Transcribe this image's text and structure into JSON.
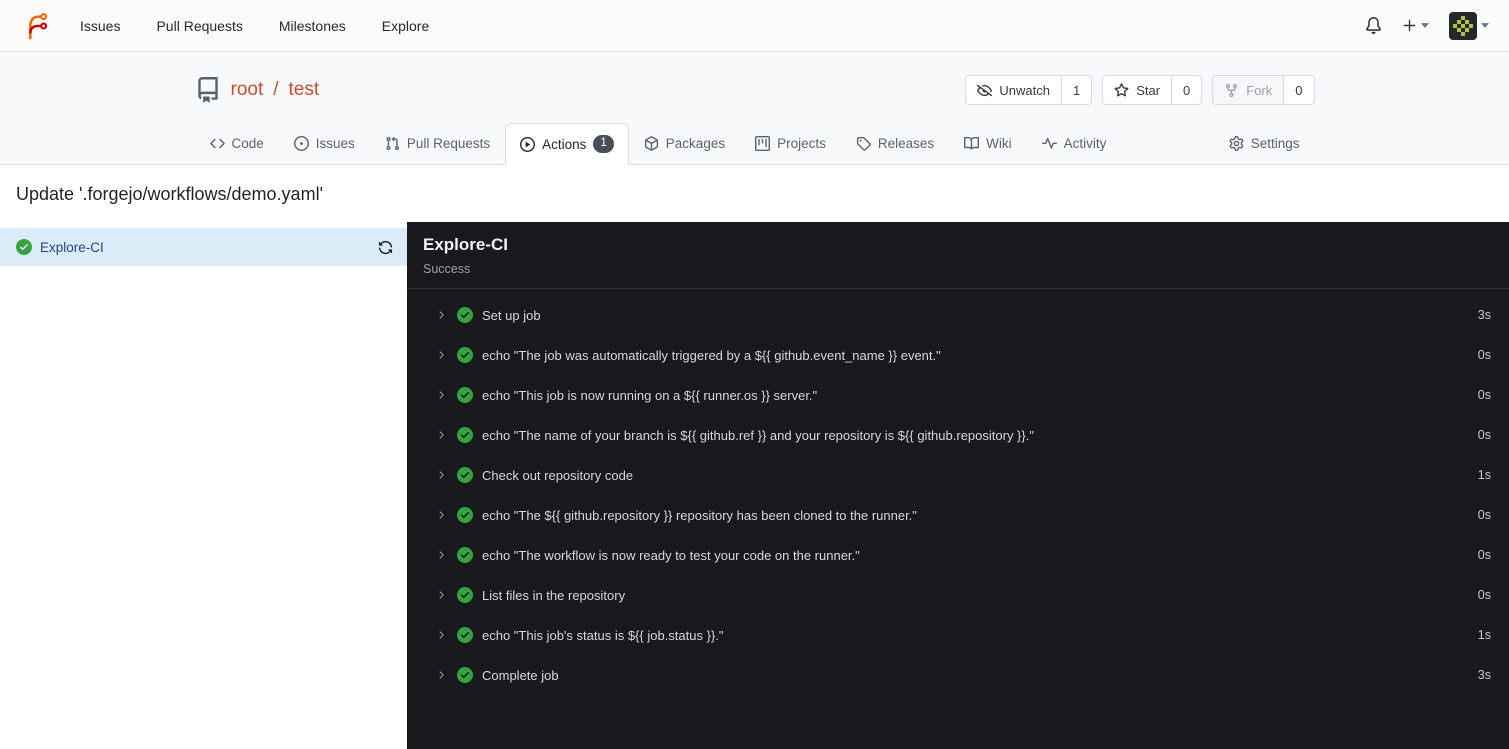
{
  "navbar": {
    "items": [
      {
        "label": "Issues"
      },
      {
        "label": "Pull Requests"
      },
      {
        "label": "Milestones"
      },
      {
        "label": "Explore"
      }
    ]
  },
  "repo": {
    "owner": "root",
    "separator": "/",
    "name": "test",
    "buttons": [
      {
        "label": "Unwatch",
        "count": "1"
      },
      {
        "label": "Star",
        "count": "0"
      },
      {
        "label": "Fork",
        "count": "0"
      }
    ]
  },
  "tabs": [
    {
      "label": "Code"
    },
    {
      "label": "Issues"
    },
    {
      "label": "Pull Requests"
    },
    {
      "label": "Actions",
      "badge": "1"
    },
    {
      "label": "Packages"
    },
    {
      "label": "Projects"
    },
    {
      "label": "Releases"
    },
    {
      "label": "Wiki"
    },
    {
      "label": "Activity"
    },
    {
      "label": "Settings"
    }
  ],
  "run": {
    "title": "Update '.forgejo/workflows/demo.yaml'",
    "sidebar": {
      "job_name": "Explore-CI"
    },
    "console": {
      "title": "Explore-CI",
      "status": "Success",
      "steps": [
        {
          "label": "Set up job",
          "duration": "3s"
        },
        {
          "label": "echo \"The job was automatically triggered by a ${{ github.event_name }} event.\"",
          "duration": "0s"
        },
        {
          "label": "echo \"This job is now running on a ${{ runner.os }} server.\"",
          "duration": "0s"
        },
        {
          "label": "echo \"The name of your branch is ${{ github.ref }} and your repository is ${{ github.repository }}.\"",
          "duration": "0s"
        },
        {
          "label": "Check out repository code",
          "duration": "1s"
        },
        {
          "label": "echo \"The ${{ github.repository }} repository has been cloned to the runner.\"",
          "duration": "0s"
        },
        {
          "label": "echo \"The workflow is now ready to test your code on the runner.\"",
          "duration": "0s"
        },
        {
          "label": "List files in the repository",
          "duration": "0s"
        },
        {
          "label": "echo \"This job's status is ${{ job.status }}.\"",
          "duration": "1s"
        },
        {
          "label": "Complete job",
          "duration": "3s"
        }
      ]
    }
  },
  "icons": [
    "forgejo-logo",
    "bell-icon",
    "plus-icon",
    "caret-down-icon",
    "avatar",
    "repo-icon",
    "eye-slash-icon",
    "star-icon",
    "fork-icon",
    "code-icon",
    "issue-icon",
    "pull-request-icon",
    "play-circle-icon",
    "package-icon",
    "project-icon",
    "tag-icon",
    "book-icon",
    "pulse-icon",
    "gear-icon",
    "check-circle-icon",
    "refresh-icon",
    "chevron-right-icon"
  ],
  "colors": {
    "brand_orange": "#ff6600",
    "brand_red": "#d40000",
    "repo_link": "#cf4a30",
    "success_green": "#35a342",
    "console_bg": "#17191d",
    "job_highlight": "#d9ecf8"
  }
}
